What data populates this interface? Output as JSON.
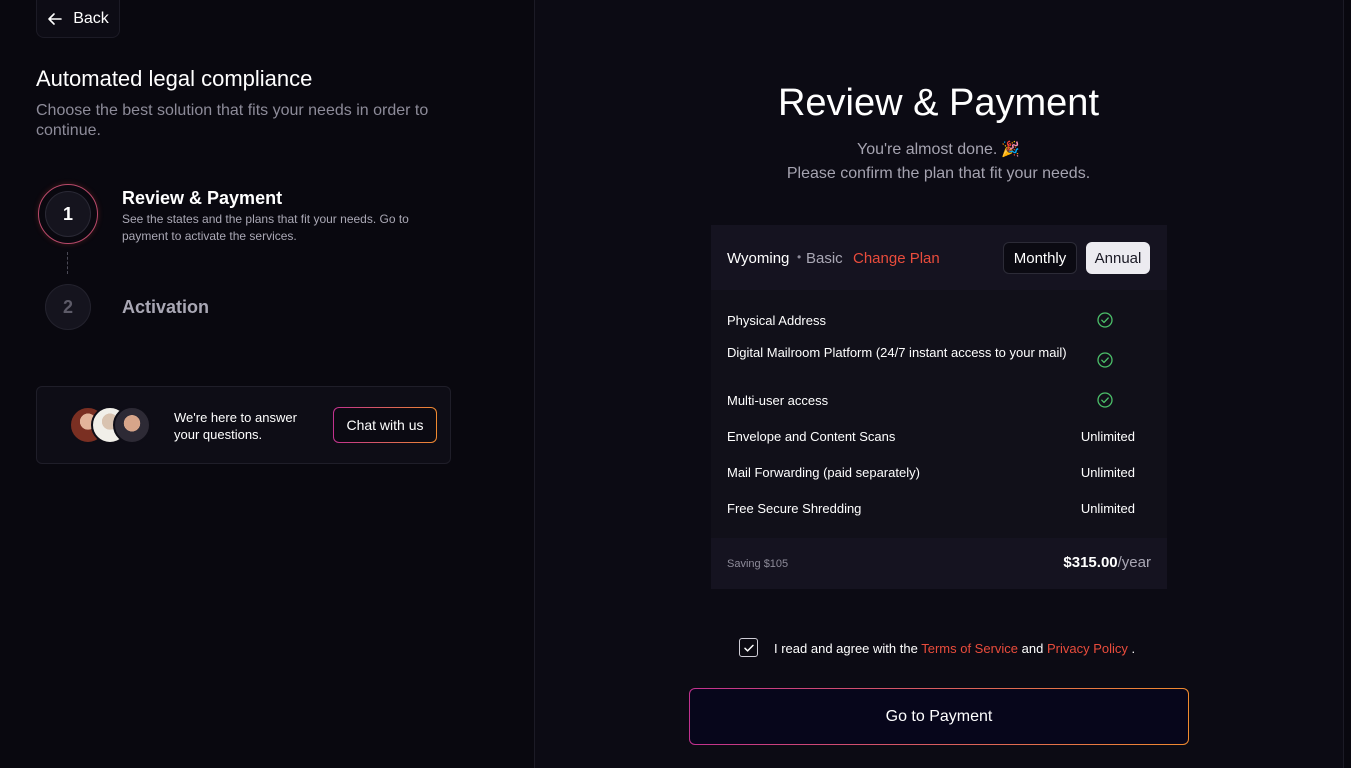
{
  "back": {
    "label": "Back"
  },
  "sidebar": {
    "title": "Automated legal compliance",
    "subtitle": "Choose the best solution that fits your needs in order to continue.",
    "steps": [
      {
        "number": "1",
        "title": "Review & Payment",
        "description": "See the states and the plans that fit your needs. Go to payment to activate the services."
      },
      {
        "number": "2",
        "title": "Activation"
      }
    ],
    "chat": {
      "text": "We're here to answer your questions.",
      "button_label": "Chat with us"
    }
  },
  "main": {
    "title": "Review & Payment",
    "subtitle_line1": "You're almost done.",
    "subtitle_line2": "Please confirm the plan that fit your needs.",
    "plan_card": {
      "state": "Wyoming",
      "separator": "•",
      "plan": "Basic",
      "change_plan_label": "Change Plan",
      "billing_tabs": [
        "Monthly",
        "Annual"
      ],
      "selected_tab": "Annual",
      "features": [
        {
          "name": "Physical Address",
          "value": "check"
        },
        {
          "name": "Digital Mailroom Platform (24/7 instant access to your mail)",
          "value": "check"
        },
        {
          "name": "Multi-user access",
          "value": "check"
        },
        {
          "name": "Envelope and Content Scans",
          "value": "Unlimited"
        },
        {
          "name": "Mail Forwarding (paid separately)",
          "value": "Unlimited"
        },
        {
          "name": "Free Secure Shredding",
          "value": "Unlimited"
        }
      ],
      "saving": "Saving $105",
      "price": "$315.00",
      "price_period": "/year"
    },
    "agreement": {
      "checked": true,
      "prefix": "I read and agree with the",
      "terms_label": "Terms of Service",
      "and": "and",
      "privacy_label": "Privacy Policy",
      "suffix": "."
    },
    "pay_button_label": "Go to Payment"
  },
  "colors": {
    "accent": "#e94c3c",
    "check_green": "#4cc06a",
    "gradient_start": "#c2318f",
    "gradient_end": "#f08a2f"
  }
}
